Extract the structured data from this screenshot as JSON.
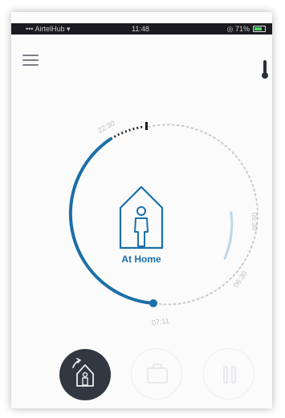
{
  "status_bar": {
    "carrier": "••• AirtelHub ▾",
    "time": "11:48",
    "right_text": "◎ 71%",
    "battery_level": 0.7
  },
  "header": {
    "menu_icon": "hamburger-menu-icon",
    "thermometer_icon": "thermometer-icon"
  },
  "schedule": {
    "mode_label": "At Home",
    "time_ticks": [
      "22:30",
      "05:30",
      "06:30",
      "07:11"
    ],
    "colors": {
      "accent": "#1c6fa8",
      "accent_light": "#bcd6ea",
      "dotted": "#c7ccd2"
    }
  },
  "mode_buttons": [
    {
      "name": "home",
      "icon": "home-person-icon",
      "active": true
    },
    {
      "name": "away",
      "icon": "briefcase-icon",
      "active": false
    },
    {
      "name": "pause",
      "icon": "pause-icon",
      "active": false
    }
  ]
}
